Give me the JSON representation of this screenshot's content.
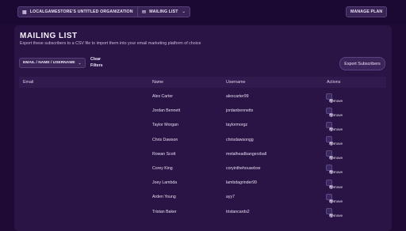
{
  "topbar": {
    "org": "LOCALGAMESTORE'S UNTITLED ORGANIZATION",
    "section": "MAILING LIST",
    "plan": "MANAGE PLAN",
    "org_icon": "building-icon",
    "section_icon": "mail-icon"
  },
  "page": {
    "title": "MAILING LIST",
    "subtitle": "Export these subscribers to a CSV file to import them into your email marketing platform of choice"
  },
  "filters": {
    "field_select": "EMAIL / NAME / USERNAME",
    "clear_label": "Clear Filters"
  },
  "export_label": "Export Subscribers",
  "table": {
    "headers": {
      "email": "Email",
      "name": "Name",
      "username": "Username",
      "actions": "Actions"
    },
    "remove_label": "Remove",
    "rows": [
      {
        "email": "",
        "name": "Alex Carter",
        "username": "alexcarter99"
      },
      {
        "email": "",
        "name": "Jordan Bennett",
        "username": "jordanbennettx"
      },
      {
        "email": "",
        "name": "Taylor Morgan",
        "username": "taylormorgz"
      },
      {
        "email": "",
        "name": "Chris Dawson",
        "username": "chrisdawsongg"
      },
      {
        "email": "",
        "name": "Rowan Scott",
        "username": "metalheadbangerzball"
      },
      {
        "email": "",
        "name": "Corey King",
        "username": "coryinthehousebxe"
      },
      {
        "email": "",
        "name": "Joey Lambda",
        "username": "lambdagrinder99"
      },
      {
        "email": "",
        "name": "Arden Young",
        "username": "ayy7"
      },
      {
        "email": "",
        "name": "Tristan Baker",
        "username": "tristancards2"
      }
    ]
  },
  "colors": {
    "background": "#1e0a35",
    "panel": "#2a1345",
    "button": "#3a2456"
  }
}
